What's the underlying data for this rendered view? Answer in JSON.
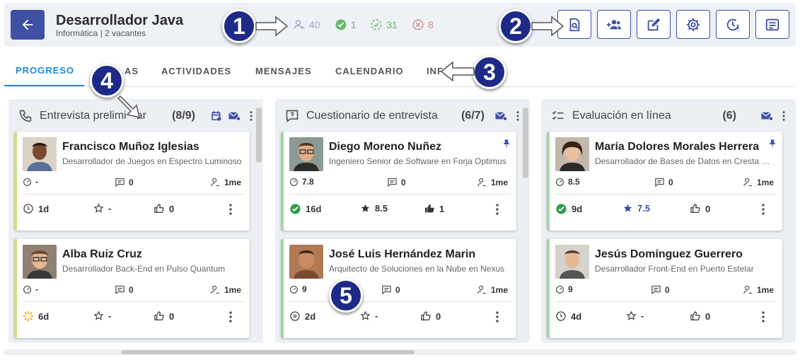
{
  "header": {
    "title": "Desarrollador Java",
    "subtitle": "Informática | 2 vacantes",
    "stats": [
      {
        "icon": "candidates-icon",
        "value": "40",
        "color": "#9fa8c7"
      },
      {
        "icon": "check-circle-icon",
        "value": "1",
        "color": "#66bb6a"
      },
      {
        "icon": "dashed-check-icon",
        "value": "31",
        "color": "#66bb6a"
      },
      {
        "icon": "cancel-circle-icon",
        "value": "8",
        "color": "#d48c8c"
      }
    ]
  },
  "toolbar": {
    "buttons": [
      "preview-icon",
      "add-candidate-icon",
      "edit-icon",
      "settings-icon",
      "history-icon",
      "notes-icon"
    ]
  },
  "tabs": [
    "PROGRESO",
    "NOTAS",
    "ACTIVIDADES",
    "MENSAJES",
    "CALENDARIO",
    "INFO"
  ],
  "tabs_visible": [
    "PROGRESO",
    "AS",
    "ACTIVIDADES",
    "MENSAJES",
    "CALENDARIO",
    "INF"
  ],
  "columns": [
    {
      "icon": "phone-icon",
      "title": "Entrevista prelimi",
      "title_tail": "ar",
      "count": "(8/9)",
      "cards": [
        {
          "name": "Francisco Muñoz Iglesias",
          "role": "Desarrollador de Juegos en Espectro Luminoso",
          "score": "-",
          "messages": "0",
          "age": "1me",
          "time": "1d",
          "time_style": "clock",
          "rating": "-",
          "rating_filled": false,
          "likes": "0",
          "likes_filled": false,
          "pinned": false
        },
        {
          "name": "Alba Ruiz Cruz",
          "role": "Desarrollador Back-End en Pulso Quantum",
          "score": "-",
          "messages": "0",
          "age": "1me",
          "time": "6d",
          "time_style": "loading",
          "rating": "-",
          "rating_filled": false,
          "likes": "0",
          "likes_filled": false,
          "pinned": false
        }
      ]
    },
    {
      "icon": "questionnaire-icon",
      "title": "Cuestionario de entrevista",
      "count": "(6/7)",
      "cards": [
        {
          "name": "Diego Moreno Nuñez",
          "role": "Ingeniero Senior de Software en Forja Optimus",
          "score": "7.8",
          "messages": "0",
          "age": "1me",
          "time": "16d",
          "time_style": "check",
          "rating": "8.5",
          "rating_filled": true,
          "likes": "1",
          "likes_filled": true,
          "pinned": true
        },
        {
          "name": "José Luis Hernández Marin",
          "role": "Arquitecto de Soluciones en la Nube en Nexus",
          "score": "9",
          "messages": "0",
          "age": "1me",
          "time": "2d",
          "time_style": "pause",
          "rating": "-",
          "rating_filled": false,
          "likes": "0",
          "likes_filled": false,
          "pinned": false
        }
      ]
    },
    {
      "icon": "checklist-icon",
      "title": "Evaluación en línea",
      "count": "(6)",
      "cards": [
        {
          "name": "María Dolores Morales Herrera",
          "role": "Desarrollador de Bases de Datos en Cresta Digital",
          "score": "8.5",
          "messages": "0",
          "age": "1me",
          "time": "9d",
          "time_style": "check",
          "rating": "7.5",
          "rating_filled": true,
          "likes": "0",
          "likes_filled": false,
          "pinned": true
        },
        {
          "name": "Jesús Domínguez Guerrero",
          "role": "Desarrollador Front-End en Puerto Estelar",
          "score": "9",
          "messages": "0",
          "age": "1me",
          "time": "4d",
          "time_style": "clock",
          "rating": "-",
          "rating_filled": false,
          "likes": "0",
          "likes_filled": false,
          "pinned": false
        }
      ]
    }
  ],
  "callouts": [
    "1",
    "2",
    "3",
    "4",
    "5"
  ],
  "colors": {
    "primary": "#3f51a5",
    "tab_active": "#1e88e5",
    "callout": "#1d2a87",
    "green": "#2e7d32",
    "orange": "#f39c12"
  }
}
